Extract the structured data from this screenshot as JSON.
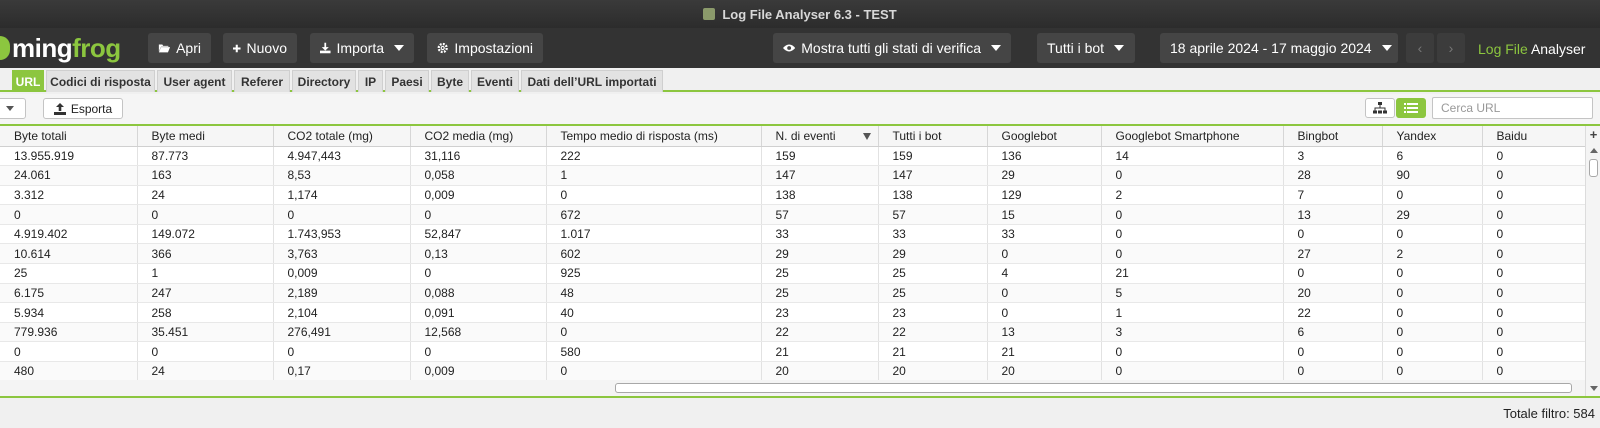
{
  "window": {
    "title": "Log File Analyser 6.3 - TEST"
  },
  "toolbar": {
    "logo_text_a": "ming",
    "logo_text_b": "frog",
    "apri": "Apri",
    "nuovo": "Nuovo",
    "importa": "Importa",
    "impostazioni": "Impostazioni",
    "verification_filter": "Mostra tutti gli stati di verifica",
    "bot_filter": "Tutti i bot",
    "date_range": "18 aprile 2024 - 17 maggio 2024",
    "prev_icon": "‹",
    "next_icon": "›",
    "brand_a": "Log File",
    "brand_b": "Analyser"
  },
  "tabs": [
    {
      "label": "URL",
      "active": true
    },
    {
      "label": "Codici di risposta"
    },
    {
      "label": "User agent"
    },
    {
      "label": "Referer"
    },
    {
      "label": "Directory"
    },
    {
      "label": "IP"
    },
    {
      "label": "Paesi"
    },
    {
      "label": "Byte"
    },
    {
      "label": "Eventi"
    },
    {
      "label": "Dati dell’URL importati"
    }
  ],
  "subbar": {
    "esporta": "Esporta",
    "search_placeholder": "Cerca URL"
  },
  "table": {
    "columns": [
      "Byte totali",
      "Byte medi",
      "CO2 totale (mg)",
      "CO2 media (mg)",
      "Tempo medio di risposta (ms)",
      "N. di eventi",
      "Tutti i bot",
      "Googlebot",
      "Googlebot Smartphone",
      "Bingbot",
      "Yandex",
      "Baidu"
    ],
    "sorted_column": "N. di eventi",
    "rows": [
      [
        "13.955.919",
        "87.773",
        "4.947,443",
        "31,116",
        "222",
        "159",
        "159",
        "136",
        "14",
        "3",
        "6",
        "0"
      ],
      [
        "24.061",
        "163",
        "8,53",
        "0,058",
        "1",
        "147",
        "147",
        "29",
        "0",
        "28",
        "90",
        "0"
      ],
      [
        "3.312",
        "24",
        "1,174",
        "0,009",
        "0",
        "138",
        "138",
        "129",
        "2",
        "7",
        "0",
        "0"
      ],
      [
        "0",
        "0",
        "0",
        "0",
        "672",
        "57",
        "57",
        "15",
        "0",
        "13",
        "29",
        "0"
      ],
      [
        "4.919.402",
        "149.072",
        "1.743,953",
        "52,847",
        "1.017",
        "33",
        "33",
        "33",
        "0",
        "0",
        "0",
        "0"
      ],
      [
        "10.614",
        "366",
        "3,763",
        "0,13",
        "602",
        "29",
        "29",
        "0",
        "0",
        "27",
        "2",
        "0"
      ],
      [
        "25",
        "1",
        "0,009",
        "0",
        "925",
        "25",
        "25",
        "4",
        "21",
        "0",
        "0",
        "0"
      ],
      [
        "6.175",
        "247",
        "2,189",
        "0,088",
        "48",
        "25",
        "25",
        "0",
        "5",
        "20",
        "0",
        "0"
      ],
      [
        "5.934",
        "258",
        "2,104",
        "0,091",
        "40",
        "23",
        "23",
        "0",
        "1",
        "22",
        "0",
        "0"
      ],
      [
        "779.936",
        "35.451",
        "276,491",
        "12,568",
        "0",
        "22",
        "22",
        "13",
        "3",
        "6",
        "0",
        "0"
      ],
      [
        "0",
        "0",
        "0",
        "0",
        "580",
        "21",
        "21",
        "21",
        "0",
        "0",
        "0",
        "0"
      ],
      [
        "480",
        "24",
        "0,17",
        "0,009",
        "0",
        "20",
        "20",
        "20",
        "0",
        "0",
        "0",
        "0"
      ],
      [
        "",
        "",
        "",
        "",
        "",
        "",
        "",
        "",
        "",
        "",
        "",
        ""
      ]
    ]
  },
  "status": {
    "total_filter": "Totale filtro: 584"
  },
  "colors": {
    "accent": "#8cc63f",
    "toolbar_bg": "#333333",
    "titlebar_bg": "#2f2f2f"
  }
}
